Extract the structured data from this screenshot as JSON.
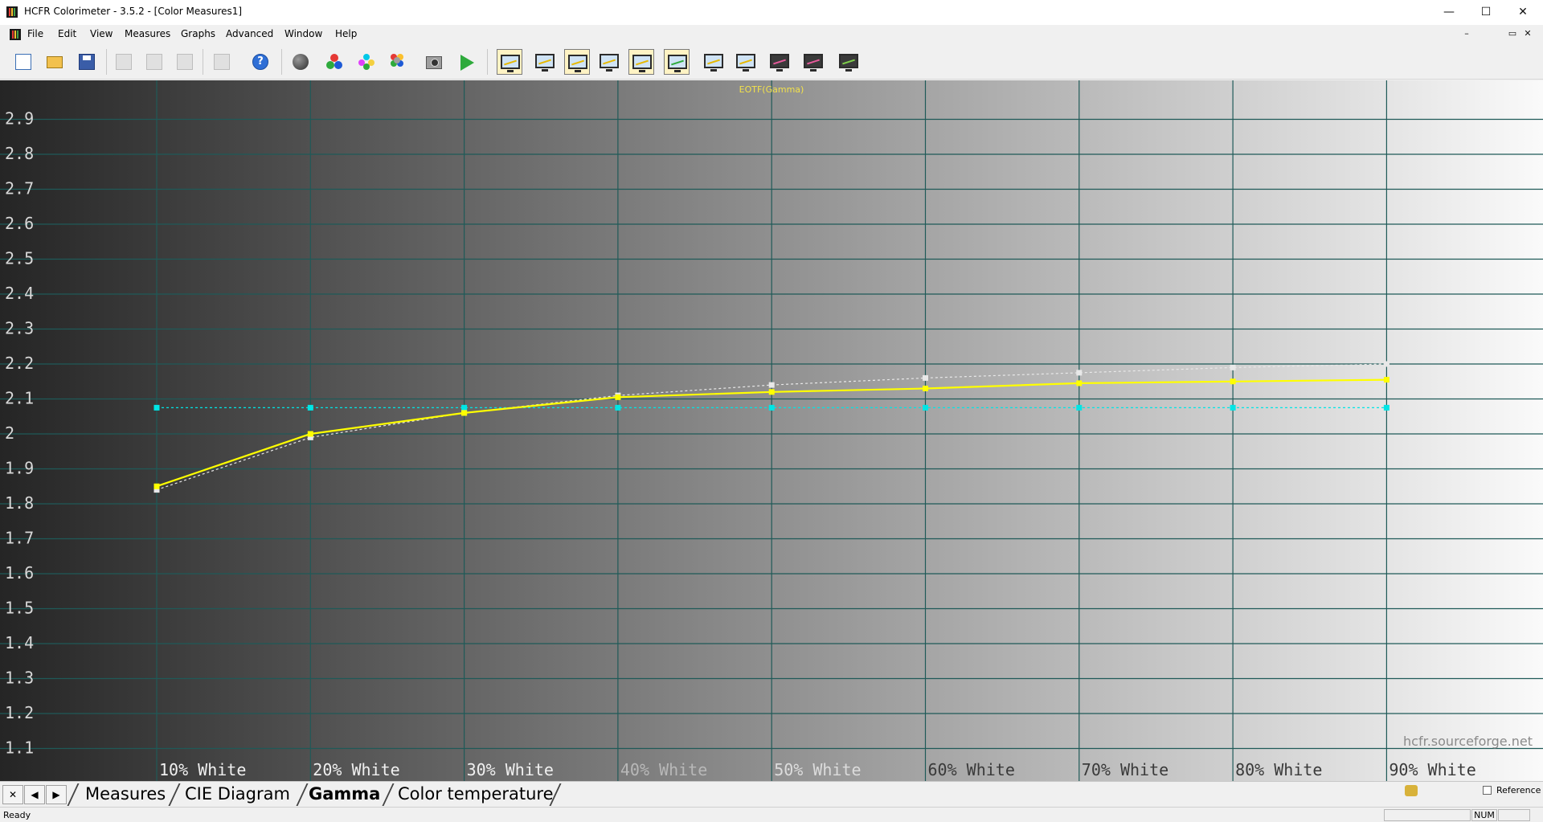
{
  "window": {
    "title": "HCFR Colorimeter - 3.5.2 - [Color Measures1]",
    "minimize_glyph": "—",
    "maximize_glyph": "☐",
    "close_glyph": "✕"
  },
  "menu": {
    "items": [
      "File",
      "Edit",
      "View",
      "Measures",
      "Graphs",
      "Advanced",
      "Window",
      "Help"
    ],
    "mdi_minimize": "–",
    "mdi_restore": "▭",
    "mdi_close": "✕"
  },
  "toolbar": {
    "buttons": [
      {
        "icon": "new-document-icon"
      },
      {
        "icon": "open-folder-icon"
      },
      {
        "icon": "save-icon"
      },
      {
        "icon": "cut-icon"
      },
      {
        "icon": "copy-icon"
      },
      {
        "icon": "paste-icon"
      },
      {
        "icon": "print-icon"
      },
      {
        "icon": "help-icon",
        "glyph": "?"
      },
      {
        "icon": "sensor-probe-icon"
      },
      {
        "icon": "rgb-primaries-icon"
      },
      {
        "icon": "secondary-colors-icon"
      },
      {
        "icon": "multi-color-icon"
      },
      {
        "icon": "camera-icon"
      },
      {
        "icon": "run-measure-icon"
      },
      {
        "icon": "graph-monitor-icon",
        "pressed": true
      },
      {
        "icon": "graph-monitor-icon"
      },
      {
        "icon": "graph-monitor-icon",
        "pressed": true
      },
      {
        "icon": "graph-monitor-icon"
      },
      {
        "icon": "graph-monitor-icon",
        "pressed": true
      },
      {
        "icon": "cie-monitor-icon",
        "pressed": true
      },
      {
        "icon": "graph-monitor-icon"
      },
      {
        "icon": "graph-monitor-icon"
      },
      {
        "icon": "graph-monitor-icon"
      },
      {
        "icon": "graph-monitor-icon"
      },
      {
        "icon": "graph-monitor-icon"
      }
    ]
  },
  "chart_data": {
    "type": "line",
    "title": "EOTF(Gamma)",
    "categories": [
      "10% White",
      "20% White",
      "30% White",
      "40% White",
      "50% White",
      "60% White",
      "70% White",
      "80% White",
      "90% White"
    ],
    "ylim": [
      1.0,
      3.0
    ],
    "yticks": [
      "2.9",
      "2.8",
      "2.7",
      "2.6",
      "2.5",
      "2.4",
      "2.3",
      "2.2",
      "2.1",
      "2",
      "1.9",
      "1.8",
      "1.7",
      "1.6",
      "1.5",
      "1.4",
      "1.3",
      "1.2",
      "1.1"
    ],
    "grid": true,
    "series": [
      {
        "color": "#ffff00",
        "style": "solid",
        "values": [
          1.85,
          2.0,
          2.06,
          2.105,
          2.12,
          2.13,
          2.145,
          2.15,
          2.155
        ]
      },
      {
        "color": "#e8e8e8",
        "style": "dotted",
        "values": [
          1.84,
          1.99,
          2.06,
          2.11,
          2.14,
          2.16,
          2.175,
          2.19,
          2.2
        ]
      },
      {
        "color": "#00e5e5",
        "style": "dotted",
        "values": [
          2.075,
          2.075,
          2.075,
          2.075,
          2.075,
          2.075,
          2.075,
          2.075,
          2.075
        ]
      }
    ],
    "watermark": "hcfr.sourceforge.net"
  },
  "tabs": {
    "close_glyph": "✕",
    "prev_glyph": "◀",
    "next_glyph": "▶",
    "items": [
      "Measures",
      "CIE Diagram",
      "Gamma",
      "Color temperature"
    ],
    "active": "Gamma",
    "reference_label": "Reference"
  },
  "status": {
    "text": "Ready",
    "num": "NUM"
  }
}
